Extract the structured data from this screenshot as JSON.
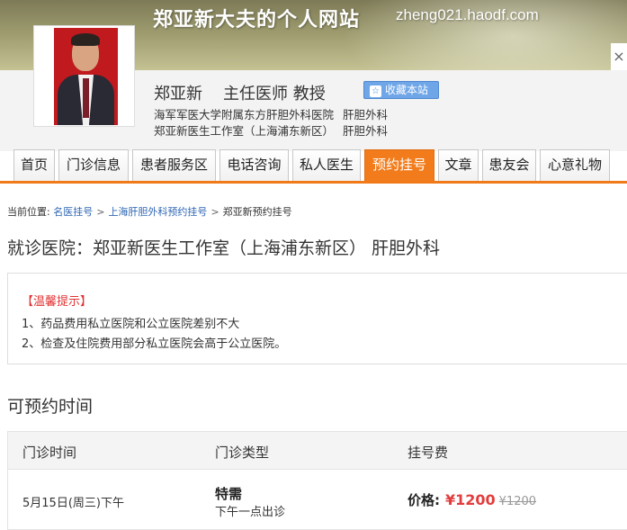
{
  "banner": {
    "title": "郑亚新大夫的个人网站",
    "domain": "zheng021.haodf.com",
    "close_label": "×"
  },
  "profile": {
    "name": "郑亚新",
    "title": "主任医师 教授",
    "favorite_label": "收藏本站",
    "favorite_icon": "☆",
    "hospitals": [
      {
        "name": "海军军医大学附属东方肝胆外科医院",
        "dept": "肝胆外科"
      },
      {
        "name": "郑亚新医生工作室（上海浦东新区）",
        "dept": "肝胆外科"
      }
    ]
  },
  "nav": {
    "tabs": [
      {
        "label": "首页"
      },
      {
        "label": "门诊信息"
      },
      {
        "label": "患者服务区"
      },
      {
        "label": "电话咨询"
      },
      {
        "label": "私人医生"
      },
      {
        "label": "预约挂号",
        "active": true
      },
      {
        "label": "文章"
      },
      {
        "label": "患友会"
      },
      {
        "label": "心意礼物"
      }
    ],
    "accent_color": "#f27c1b"
  },
  "breadcrumb": {
    "prefix": "当前位置:",
    "items": [
      "名医挂号",
      "上海肝胆外科预约挂号",
      "郑亚新预约挂号"
    ]
  },
  "visit_hospital": "就诊医院：郑亚新医生工作室（上海浦东新区） 肝胆外科",
  "notice": {
    "title": "【温馨提示】",
    "lines": [
      "1、药品费用私立医院和公立医院差别不大",
      "2、检查及住院费用部分私立医院会高于公立医院。"
    ]
  },
  "schedule": {
    "section_title": "可预约时间",
    "headers": [
      "门诊时间",
      "门诊类型",
      "挂号费"
    ],
    "rows": [
      {
        "time": "5月15日(周三)下午",
        "type": "特需",
        "type_note": "下午一点出诊",
        "price_label": "价格:",
        "price": "¥1200",
        "original_price": "¥1200"
      }
    ]
  }
}
